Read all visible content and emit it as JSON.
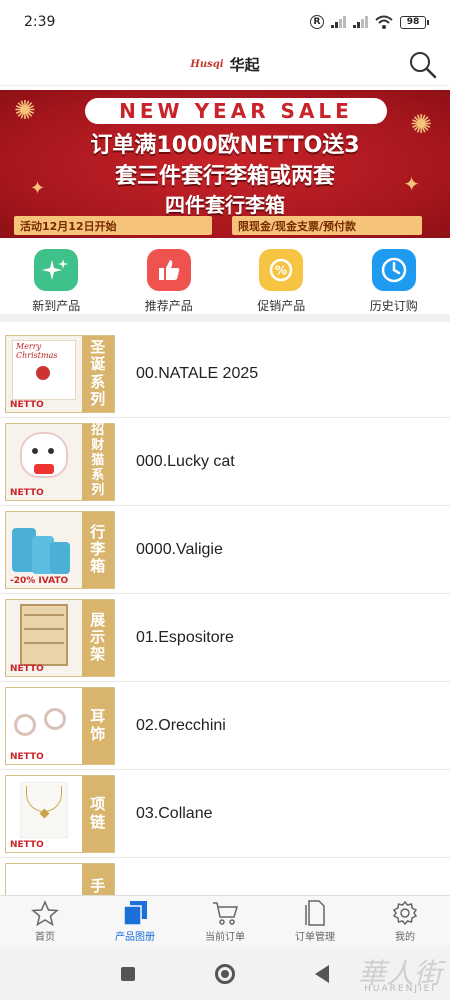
{
  "status_bar": {
    "time": "2:39",
    "battery": "98"
  },
  "header": {
    "logo_mark": "Husqi",
    "title": "华起"
  },
  "banner": {
    "headline": "NEW YEAR SALE",
    "line1": "订单满1000欧NETTO送3",
    "line2": "套三件套行李箱或两套",
    "line3": "四件套行李箱",
    "tag_left": "活动12月12日开始",
    "tag_right": "限现金/现金支票/预付款"
  },
  "quick_nav": [
    {
      "label": "新到产品",
      "icon": "sparkle-icon",
      "color": "#3fc28a"
    },
    {
      "label": "推荐产品",
      "icon": "thumbs-up-icon",
      "color": "#ef5350"
    },
    {
      "label": "促销产品",
      "icon": "discount-icon",
      "color": "#f6c343"
    },
    {
      "label": "历史订购",
      "icon": "clock-icon",
      "color": "#1e9bf0"
    }
  ],
  "categories": [
    {
      "name": "00.NATALE 2025",
      "label": [
        "圣",
        "诞",
        "系",
        "列"
      ],
      "tag": "NETTO"
    },
    {
      "name": "000.Lucky cat",
      "label": [
        "招",
        "财",
        "猫",
        "系",
        "列"
      ],
      "tag": "NETTO"
    },
    {
      "name": "0000.Valigie",
      "label": [
        "行",
        "李",
        "箱"
      ],
      "tag": "-20% IVATO"
    },
    {
      "name": "01.Espositore",
      "label": [
        "展",
        "示",
        "架"
      ],
      "tag": "NETTO"
    },
    {
      "name": "02.Orecchini",
      "label": [
        "耳",
        "饰"
      ],
      "tag": "NETTO"
    },
    {
      "name": "03.Collane",
      "label": [
        "项",
        "链"
      ],
      "tag": "NETTO"
    },
    {
      "name": "",
      "label": [
        "手"
      ],
      "tag": ""
    }
  ],
  "bottom_nav": [
    {
      "label": "首页",
      "icon": "star-icon"
    },
    {
      "label": "产品图册",
      "icon": "catalog-icon"
    },
    {
      "label": "当前订单",
      "icon": "cart-icon"
    },
    {
      "label": "订单管理",
      "icon": "document-icon"
    },
    {
      "label": "我的",
      "icon": "gear-icon"
    }
  ],
  "watermark": {
    "text": "華人街",
    "sub": "HUARENJIEI"
  },
  "colors": {
    "accent": "#1a6fd8",
    "banner_red": "#c8242a",
    "label_gold": "#d9b46d"
  }
}
